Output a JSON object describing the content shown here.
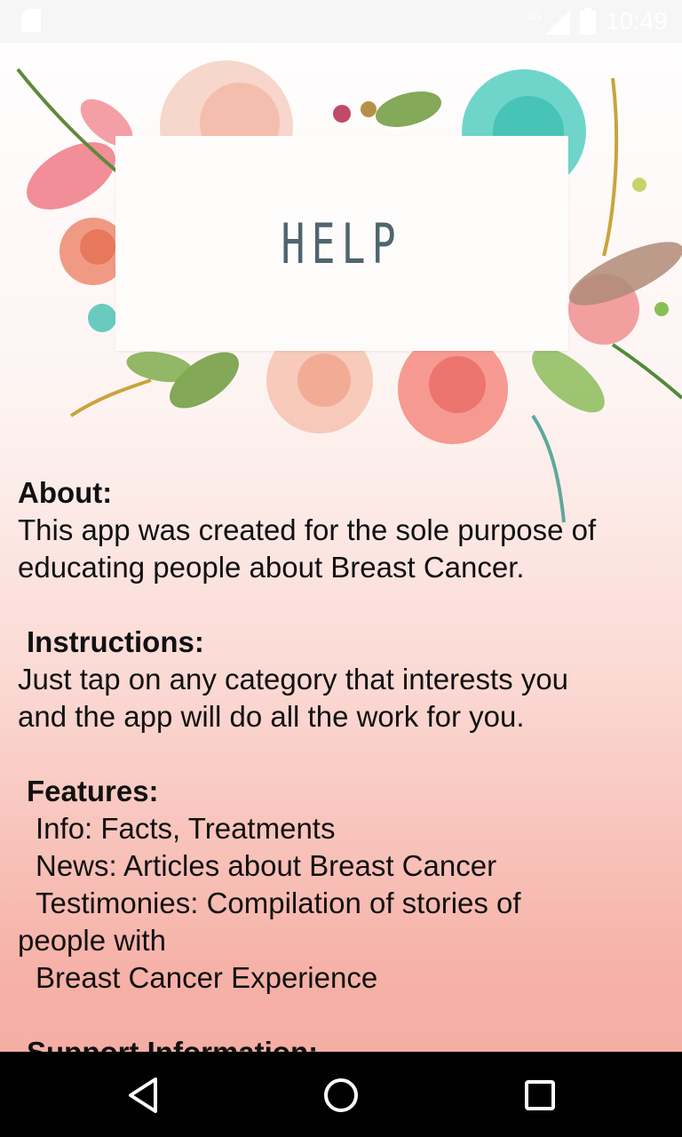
{
  "status_bar": {
    "time": "10:49",
    "network_label": "3G",
    "icons": [
      "sd-card-icon",
      "signal-icon",
      "battery-icon"
    ]
  },
  "banner": {
    "title": "HELP"
  },
  "sections": {
    "about": {
      "heading": "About:",
      "body_line_1": "This app was created for the sole purpose of",
      "body_line_2": "educating people about Breast Cancer."
    },
    "instructions": {
      "heading": "Instructions:",
      "body_line_1": "Just tap on any category that interests you",
      "body_line_2": "and the app will do all the work for you."
    },
    "features": {
      "heading": "Features:",
      "item_1": "Info: Facts, Treatments",
      "item_2": "News: Articles about Breast Cancer",
      "item_3_line_1": "Testimonies: Compilation of stories of",
      "item_3_line_2": "people with",
      "item_3_line_3": "Breast Cancer Experience"
    },
    "support": {
      "heading": "Support Information:"
    }
  },
  "nav_bar": {
    "buttons": [
      "back-icon",
      "home-icon",
      "recents-icon"
    ]
  },
  "colors": {
    "status_bar_bg": "#f6f6f6",
    "help_text": "#4f6570",
    "nav_bar_bg": "#000000",
    "body_text": "#111111"
  }
}
